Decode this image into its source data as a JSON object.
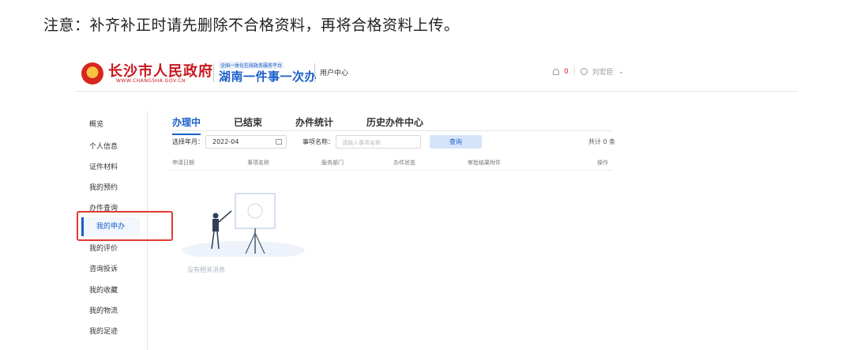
{
  "notice": "注意：补齐补正时请先删除不合格资料，再将合格资料上传。",
  "header": {
    "city_name": "长沙市人民政府",
    "city_url": "WWW.CHANGSHA.GOV.CN",
    "slogan_top": "全国一体化在线政务服务平台",
    "slogan": "湖南一件事一次办",
    "user_center": "用户中心",
    "notif_count": "0",
    "separator": "|",
    "username": "刘宏臣",
    "chevron": "⌄"
  },
  "sidebar": {
    "items": [
      {
        "label": "概览"
      },
      {
        "label": "个人信息"
      },
      {
        "label": "证件材料"
      },
      {
        "label": "我的预约"
      },
      {
        "label": "办件查询"
      },
      {
        "label": "我的申办"
      },
      {
        "label": "我的评价"
      },
      {
        "label": "咨询投诉"
      },
      {
        "label": "我的收藏"
      },
      {
        "label": "我的物流"
      },
      {
        "label": "我的足迹"
      }
    ],
    "active_index": 5
  },
  "tabs": [
    {
      "label": "办理中"
    },
    {
      "label": "已结束"
    },
    {
      "label": "办件统计"
    },
    {
      "label": "历史办件中心"
    }
  ],
  "filter": {
    "month_label": "选择年月：",
    "month_value": "2022-04",
    "name_label": "事项名称：",
    "name_placeholder": "请输入事项名称",
    "query_label": "查询",
    "total": "共计 0 条"
  },
  "table": {
    "columns": [
      "申请日期",
      "事项名称",
      "服务部门",
      "办件状态",
      "审批结果附件",
      "操作"
    ]
  },
  "empty_text": "没有相关消息",
  "colors": {
    "brand_red": "#c8161e",
    "brand_blue": "#1a5fc8",
    "highlight_red": "#e33a2f"
  }
}
